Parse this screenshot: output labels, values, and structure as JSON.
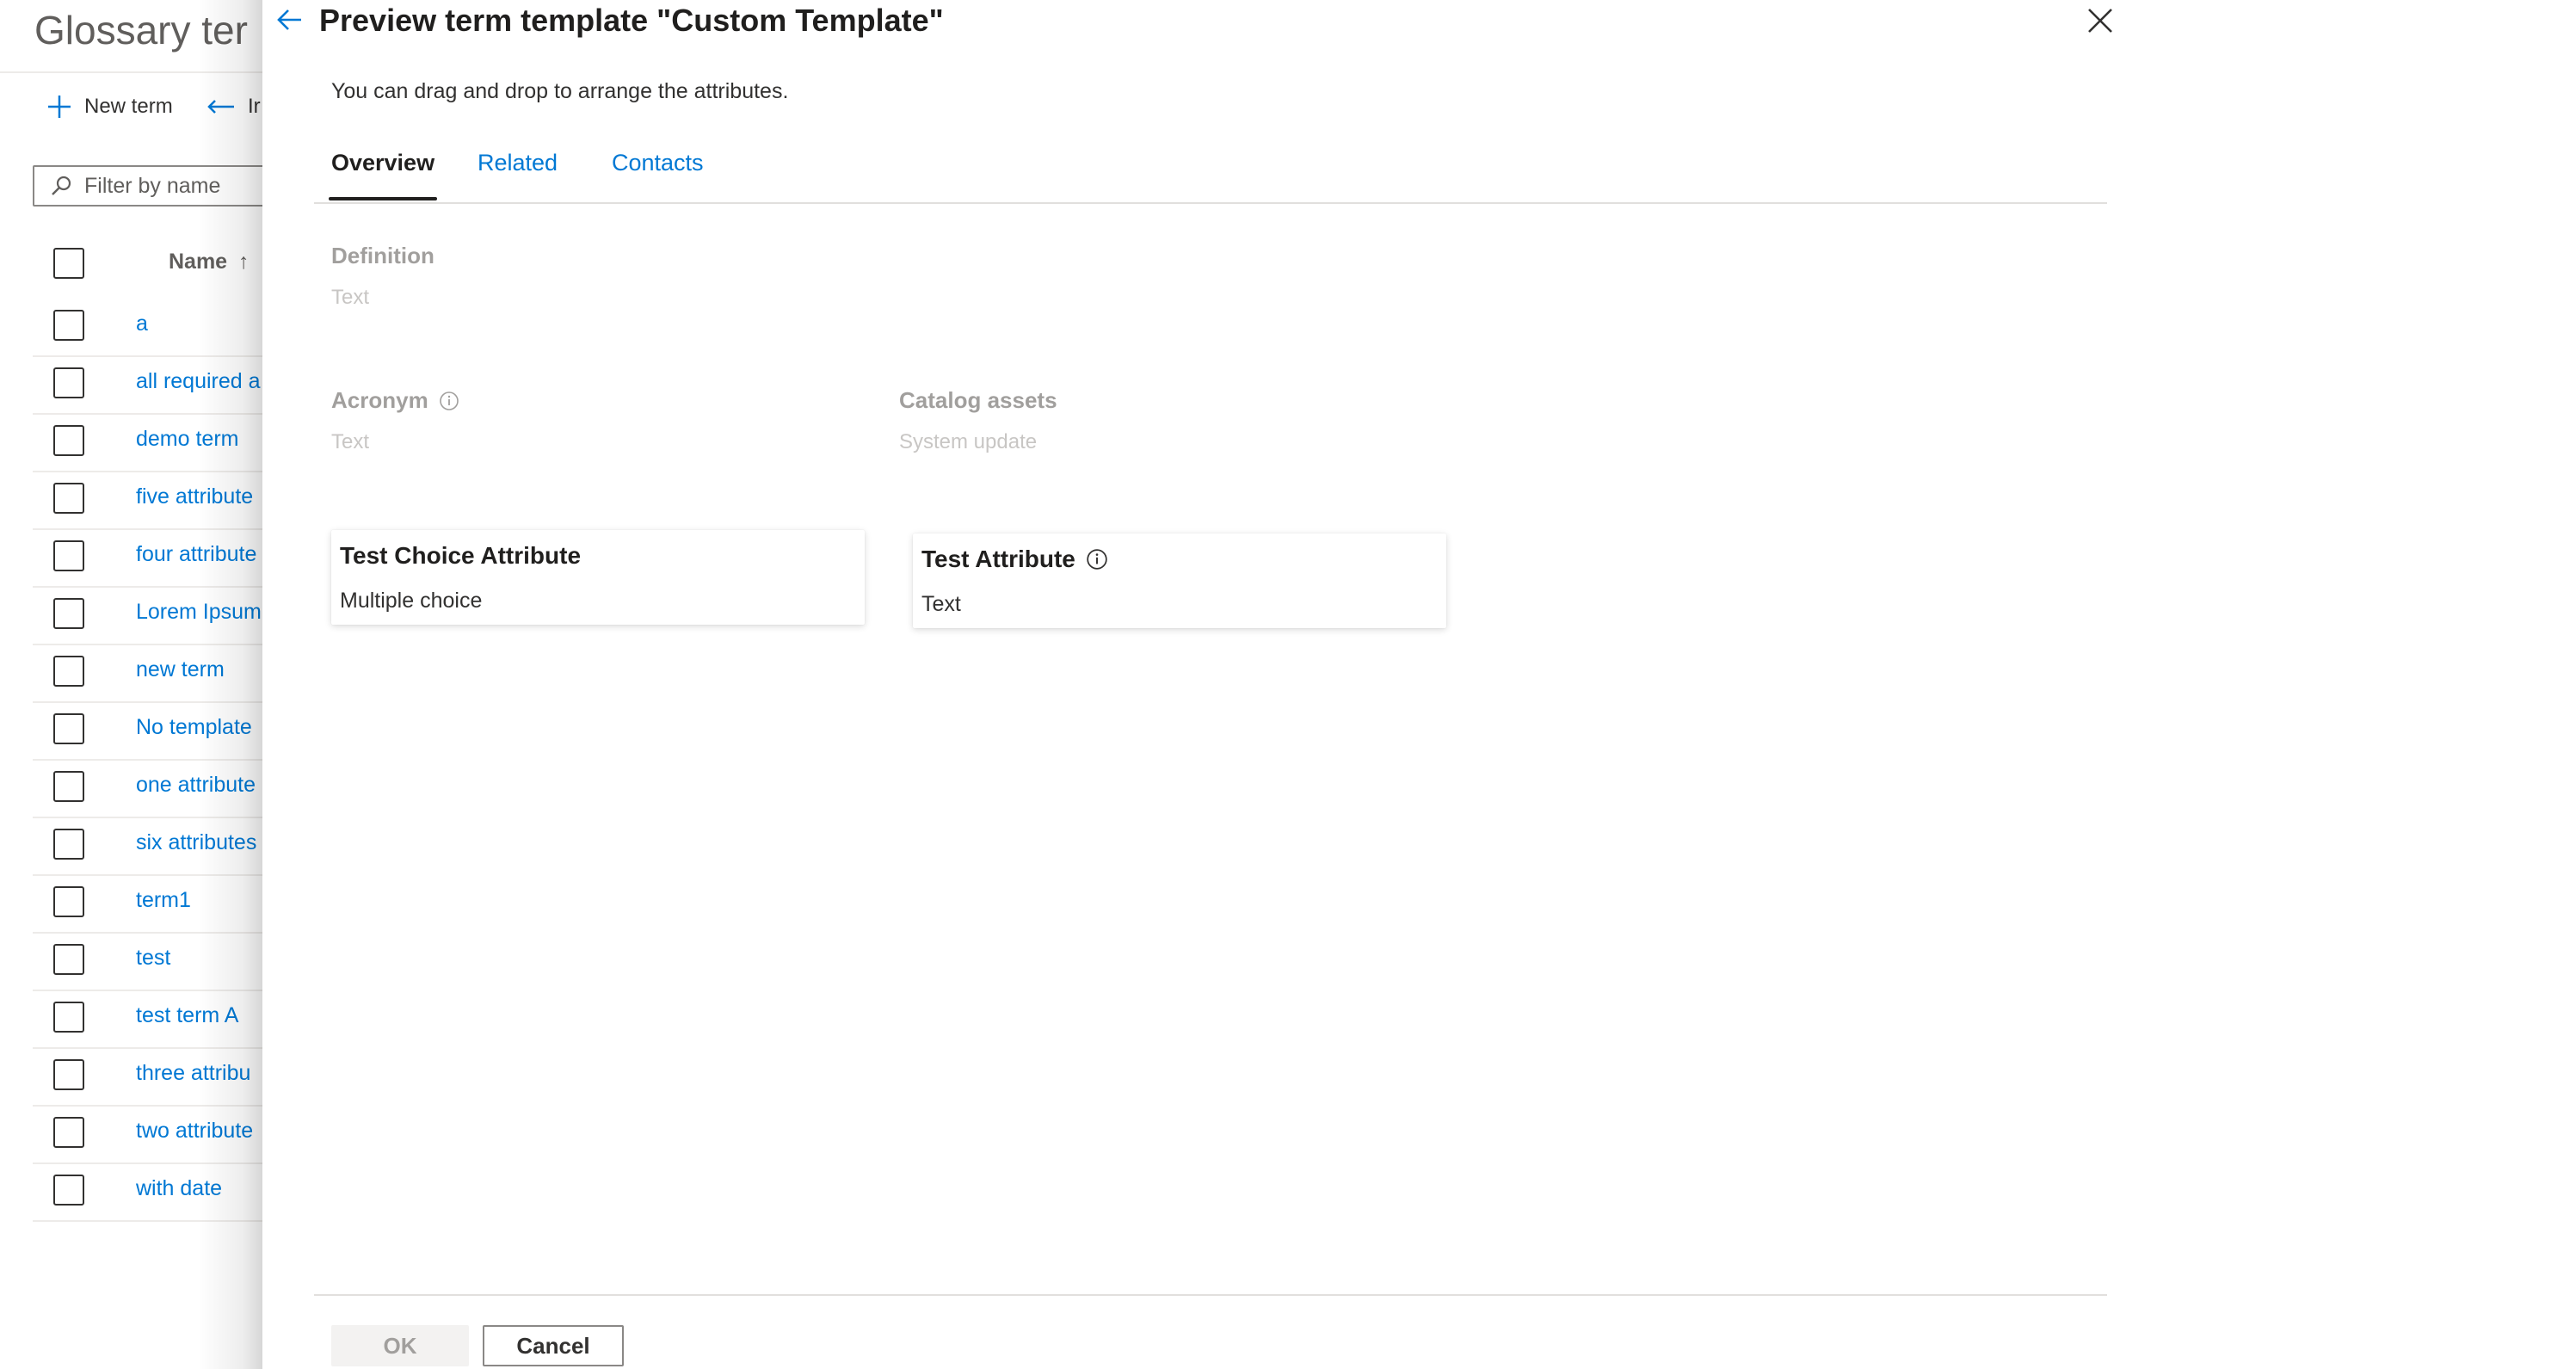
{
  "background": {
    "title": "Glossary ter",
    "toolbar": {
      "new_term": "New term",
      "import_partial": "Ir"
    },
    "filter_placeholder": "Filter by name",
    "list_header": {
      "name": "Name",
      "sort_glyph": "↑"
    },
    "rows": [
      "a",
      "all required a",
      "demo term",
      "five attribute",
      "four attribute",
      "Lorem Ipsum",
      "new term",
      "No template",
      "one attribute",
      "six attributes",
      "term1",
      "test",
      "test term A",
      "three attribu",
      "two attribute",
      "with date"
    ]
  },
  "panel": {
    "title": "Preview term template \"Custom Template\"",
    "subtitle": "You can drag and drop to arrange the attributes.",
    "tabs": [
      "Overview",
      "Related",
      "Contacts"
    ],
    "active_tab": "Overview",
    "fields": {
      "definition": {
        "label": "Definition",
        "type": "Text"
      },
      "acronym": {
        "label": "Acronym",
        "type": "Text",
        "icon": "info-icon"
      },
      "catalog_assets": {
        "label": "Catalog assets",
        "type": "System update"
      }
    },
    "cards": [
      {
        "title": "Test Choice Attribute",
        "type": "Multiple choice"
      },
      {
        "title": "Test Attribute",
        "type": "Text",
        "icon": "info-icon"
      }
    ],
    "buttons": {
      "ok": "OK",
      "cancel": "Cancel"
    }
  },
  "colors": {
    "accent": "#0078d4",
    "text": "#323130",
    "disabled_text": "#a19f9d",
    "placeholder_text": "#c8c6c4",
    "divider": "#e1dfdd"
  }
}
